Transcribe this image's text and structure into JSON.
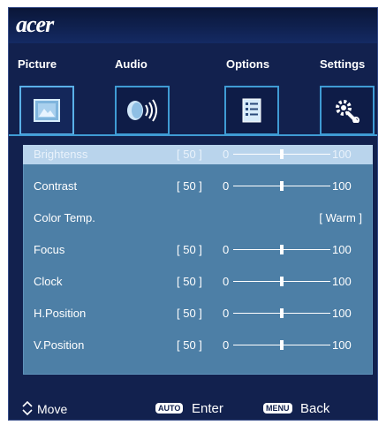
{
  "brand": {
    "logo": "acer"
  },
  "tabs": [
    {
      "label": "Picture"
    },
    {
      "label": "Audio"
    },
    {
      "label": "Options"
    },
    {
      "label": "Settings"
    }
  ],
  "rows": [
    {
      "label": "Brightenss",
      "value": "[ 50 ]",
      "min": "0",
      "max": "100",
      "level": 0.5,
      "selected": true
    },
    {
      "label": "Contrast",
      "value": "[ 50 ]",
      "min": "0",
      "max": "100",
      "level": 0.5
    },
    {
      "label": "Color Temp.",
      "text_value": "[ Warm ]"
    },
    {
      "label": "Focus",
      "value": "[ 50 ]",
      "min": "0",
      "max": "100",
      "level": 0.5
    },
    {
      "label": "Clock",
      "value": "[ 50 ]",
      "min": "0",
      "max": "100",
      "level": 0.5
    },
    {
      "label": "H.Position",
      "value": "[ 50 ]",
      "min": "0",
      "max": "100",
      "level": 0.5
    },
    {
      "label": "V.Position",
      "value": "[ 50 ]",
      "min": "0",
      "max": "100",
      "level": 0.5
    }
  ],
  "footer": {
    "move_label": "Move",
    "auto_badge": "AUTO",
    "enter_label": "Enter",
    "menu_badge": "MENU",
    "back_label": "Back"
  },
  "colors": {
    "background": "#12214e",
    "accent": "#3f9bd4",
    "panel": "#4d7fa6",
    "selected_row": "#b9d4ec"
  }
}
